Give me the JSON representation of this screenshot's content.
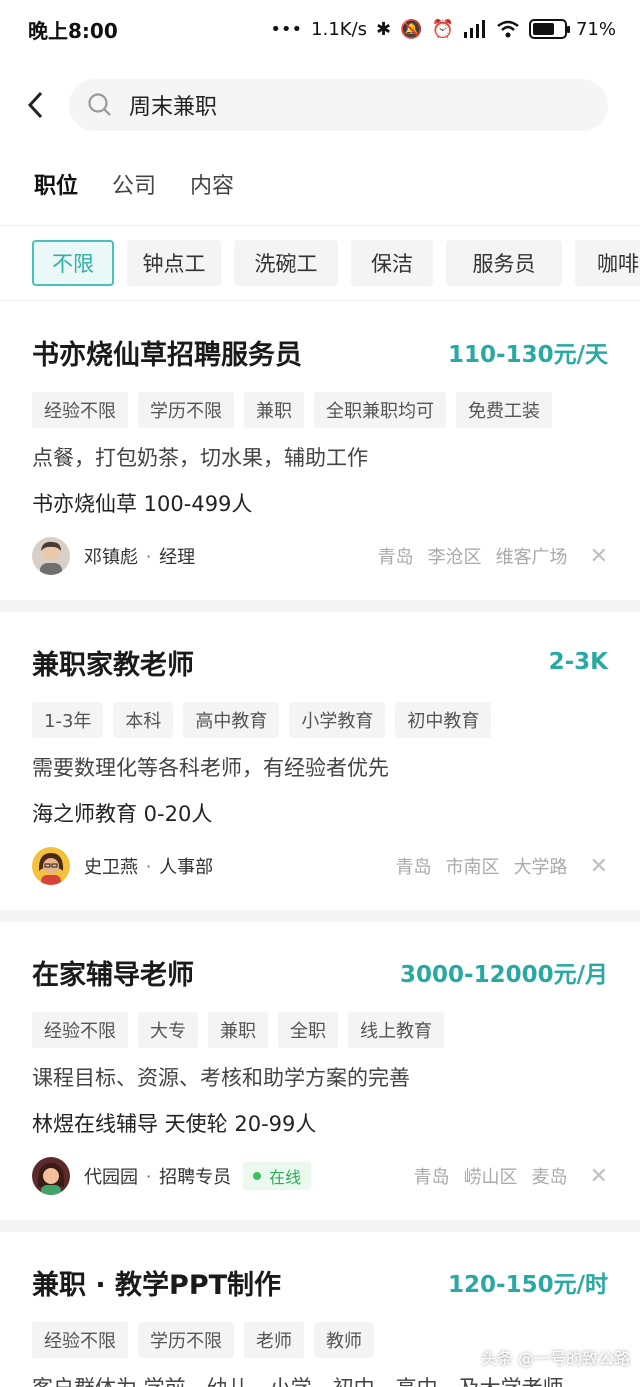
{
  "status": {
    "time": "晚上8:00",
    "speed": "1.1K/s",
    "battery": "71%",
    "battery_level": 0.71
  },
  "search": {
    "query": "周末兼职"
  },
  "type_tabs": [
    "职位",
    "公司",
    "内容"
  ],
  "filters": [
    "不限",
    "钟点工",
    "洗碗工",
    "保洁",
    "服务员",
    "咖啡"
  ],
  "jobs": [
    {
      "title": "书亦烧仙草招聘服务员",
      "salary": "110-130元/天",
      "tags": [
        "经验不限",
        "学历不限",
        "兼职",
        "全职兼职均可",
        "免费工装"
      ],
      "desc": "点餐，打包奶茶，切水果，辅助工作",
      "company": "书亦烧仙草  100-499人",
      "recruiter": "邓镇彪",
      "role": "经理",
      "loc": [
        "青岛",
        "李沧区",
        "维客广场"
      ]
    },
    {
      "title": "兼职家教老师",
      "salary": "2-3K",
      "tags": [
        "1-3年",
        "本科",
        "高中教育",
        "小学教育",
        "初中教育"
      ],
      "desc": "需要数理化等各科老师，有经验者优先",
      "company": "海之师教育  0-20人",
      "recruiter": "史卫燕",
      "role": "人事部",
      "loc": [
        "青岛",
        "市南区",
        "大学路"
      ]
    },
    {
      "title": "在家辅导老师",
      "salary": "3000-12000元/月",
      "tags": [
        "经验不限",
        "大专",
        "兼职",
        "全职",
        "线上教育"
      ],
      "desc": "课程目标、资源、考核和助学方案的完善",
      "company": "林煜在线辅导  天使轮  20-99人",
      "recruiter": "代园园",
      "role": "招聘专员",
      "online": "在线",
      "loc": [
        "青岛",
        "崂山区",
        "麦岛"
      ]
    },
    {
      "title": "兼职 · 教学PPT制作",
      "salary": "120-150元/时",
      "tags": [
        "经验不限",
        "学历不限",
        "老师",
        "教师"
      ],
      "desc": "客户群体为 学前、幼儿、小学、初中、高中、及大学老师"
    }
  ],
  "watermark": "头条 @一号的致公路"
}
